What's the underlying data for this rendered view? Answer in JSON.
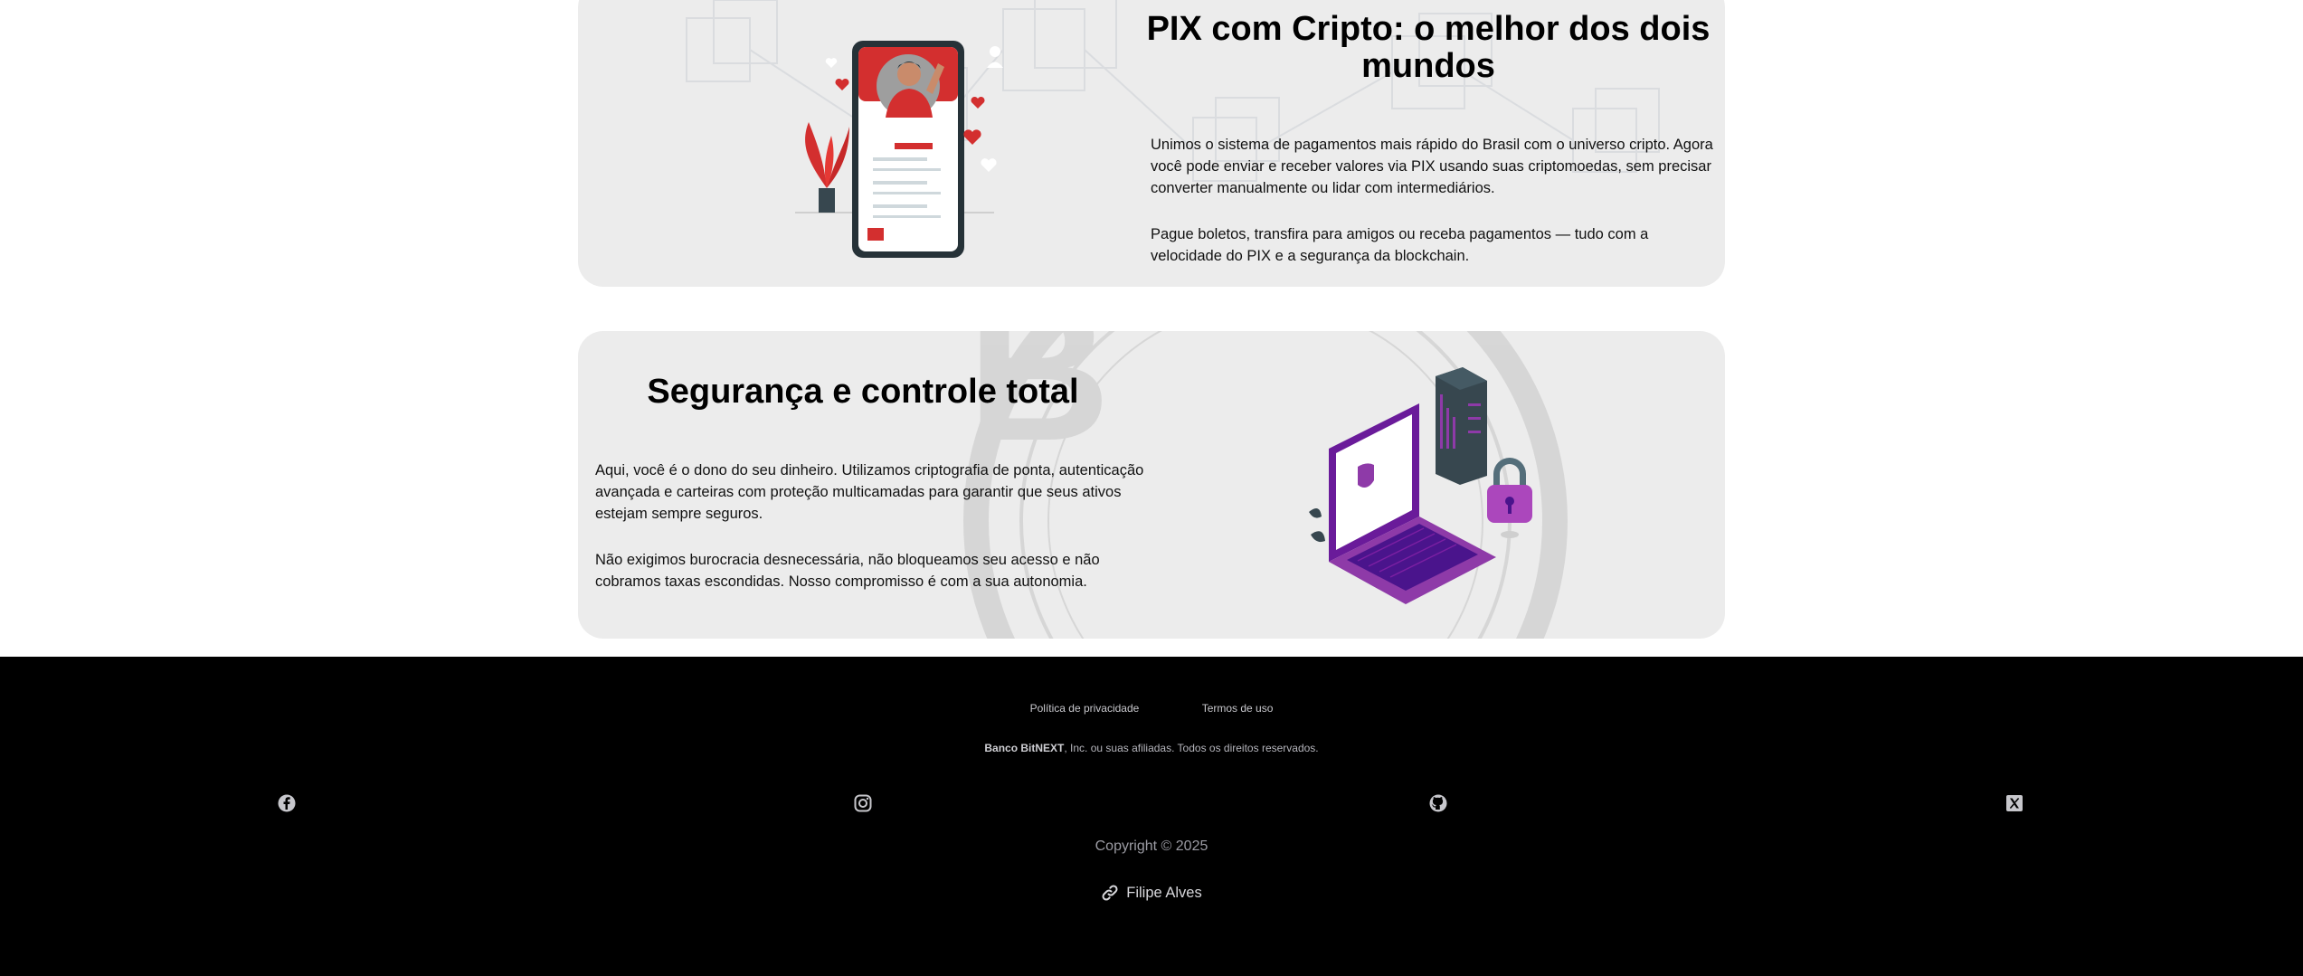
{
  "sections": {
    "pix": {
      "title": "PIX com Cripto: o melhor dos dois mundos",
      "paragraphs": [
        "Unimos o sistema de pagamentos mais rápido do Brasil com o universo cripto. Agora você pode enviar e receber valores via PIX usando suas criptomoedas, sem precisar converter manualmente ou lidar com intermediários.",
        "Pague boletos, transfira para amigos ou receba pagamentos — tudo com a velocidade do PIX e a segurança da blockchain."
      ],
      "illustration": "phone-payment-illustration"
    },
    "security": {
      "title": "Segurança e controle total",
      "paragraphs": [
        "Aqui, você é o dono do seu dinheiro. Utilizamos criptografia de ponta, autenticação avançada e carteiras com proteção multicamadas para garantir que seus ativos estejam sempre seguros.",
        "Não exigimos burocracia desnecessária, não bloqueamos seu acesso e não cobramos taxas escondidas. Nosso compromisso é com a sua autonomia."
      ],
      "illustration": "laptop-security-illustration"
    }
  },
  "footer": {
    "links": [
      "Política de privacidade",
      "Termos de uso"
    ],
    "legal_brand": "Banco BitNEXT",
    "legal_rest": ", Inc. ou suas afiliadas. Todos os direitos reservados.",
    "social": [
      "facebook-icon",
      "instagram-icon",
      "github-icon",
      "x-icon"
    ],
    "copyright": "Copyright © 2025",
    "author": "Filipe Alves",
    "colors": {
      "background": "#000000",
      "link": "#c7c7cc",
      "muted": "#9b9ba3"
    }
  },
  "colors": {
    "card_background": "#ececec",
    "accent_red": "#d32f2f",
    "accent_purple": "#8e3aa8"
  }
}
